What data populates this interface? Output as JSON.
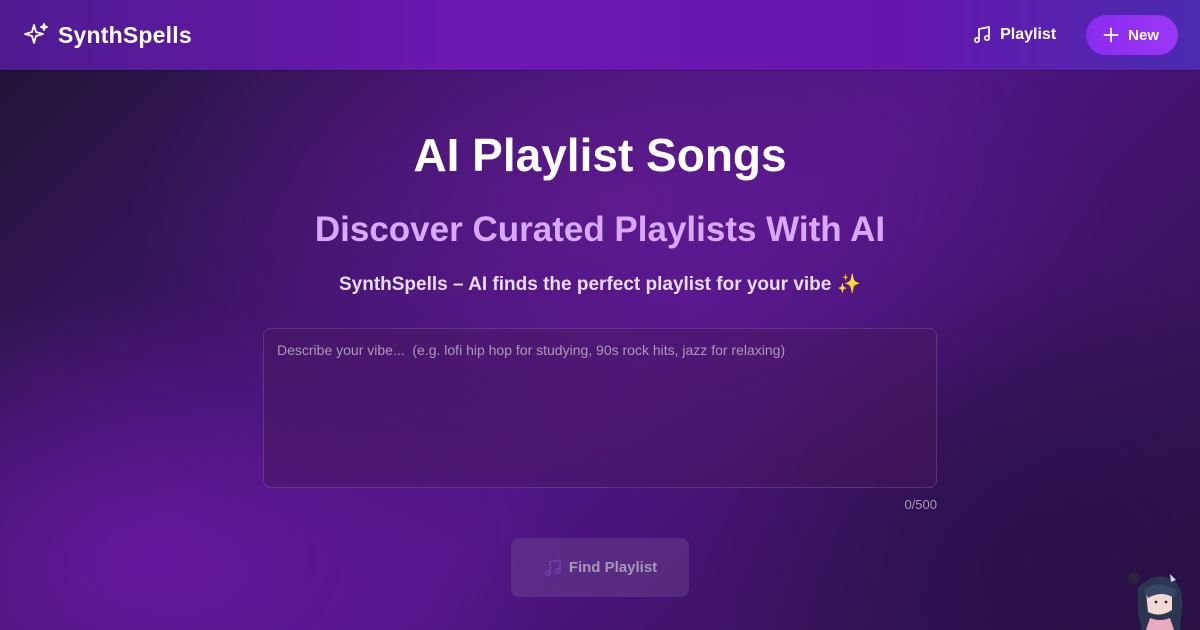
{
  "navbar": {
    "brand_name": "SynthSpells",
    "brand_icon": "sparkle-icon",
    "playlist_label": "Playlist",
    "playlist_icon": "music-note-icon",
    "new_label": "New",
    "new_icon": "plus-icon"
  },
  "hero": {
    "title": "AI Playlist Songs",
    "subtitle": "Discover Curated Playlists With AI",
    "tagline": "SynthSpells – AI finds the perfect playlist for your vibe",
    "tagline_emoji": "✨"
  },
  "prompt": {
    "placeholder": "Describe your vibe...  (e.g. lofi hip hop for studying, 90s rock hits, jazz for relaxing)",
    "value": "",
    "char_count": "0/500"
  },
  "find_button": {
    "label": "Find Playlist",
    "icon": "music-note-icon"
  },
  "mascot": {
    "icon": "anime-mascot-avatar"
  },
  "colors": {
    "accent": "#9b36f5",
    "subtitle": "#d7aaff",
    "navbar": "#6c18b2"
  }
}
